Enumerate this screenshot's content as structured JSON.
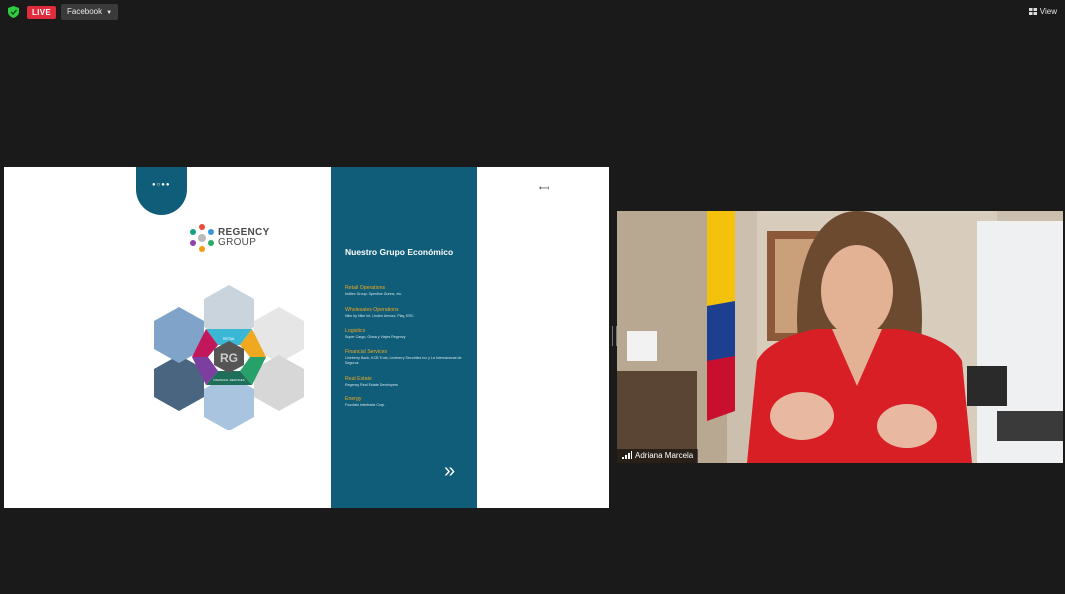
{
  "topbar": {
    "live_label": "LIVE",
    "destination_label": "Facebook",
    "view_label": "View"
  },
  "slide": {
    "logo_line1": "REGENCY",
    "logo_line2": "GROUP",
    "hex_center": "RG",
    "hex_labels": [
      "RETAIL",
      "WHOLESALE",
      "LOGISTICS",
      "FINANCIAL SERVICES",
      "REAL ESTATE",
      "ENERGY"
    ],
    "title": "Nuestro Grupo Económico",
    "sections": [
      {
        "heading": "Retail Operations",
        "body": "Inditex Group: Spenfine Gunns, etc."
      },
      {
        "heading": " Wholesales Operations",
        "body": "Nike by Nike Int, Linden Armour, Play, ERC"
      },
      {
        "heading": "Logistics",
        "body": "Super Cargo, Glosa y Viajes Regency"
      },
      {
        "heading": "Financial Services",
        "body": "Lineberry Bank, KCB Trust, Lineberry Securities Inc y La Internacional de Seguros"
      },
      {
        "heading": "Real Estate",
        "body": "Regency Real Estate Developers"
      },
      {
        "heading": "Energy",
        "body": "Fountain Interfrade Corp."
      }
    ],
    "next_glyph": "»"
  },
  "video": {
    "participant_name": "Adriana Marcela"
  },
  "colors": {
    "teal": "#0f5d78",
    "live": "#e02b3c",
    "accent_orange": "#f0a820"
  }
}
